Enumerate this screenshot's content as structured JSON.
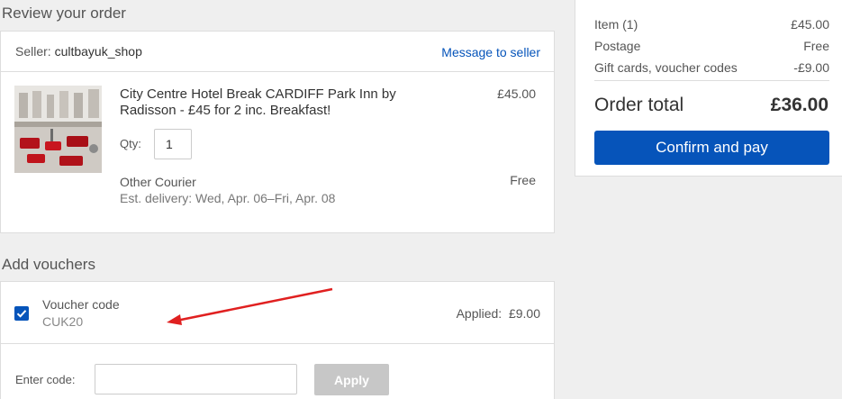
{
  "review": {
    "heading": "Review your order",
    "seller_label": "Seller:",
    "seller_name": "cultbayuk_shop",
    "message_link": "Message to seller",
    "item": {
      "title": "City Centre Hotel Break CARDIFF Park Inn by Radisson - £45 for 2 inc. Breakfast!",
      "price": "£45.00",
      "qty_label": "Qty:",
      "qty_value": "1",
      "courier": "Other Courier",
      "delivery": "Est. delivery: Wed, Apr. 06–Fri, Apr. 08",
      "shipping_cost": "Free"
    }
  },
  "vouchers": {
    "heading": "Add vouchers",
    "voucher_label": "Voucher code",
    "voucher_code": "CUK20",
    "applied_text": "Applied:  £9.00",
    "enter_label": "Enter code:",
    "enter_value": "",
    "apply_button": "Apply"
  },
  "summary": {
    "rows": [
      {
        "label": "Item (1)",
        "value": "£45.00"
      },
      {
        "label": "Postage",
        "value": "Free"
      },
      {
        "label": "Gift cards, voucher codes",
        "value": "-£9.00"
      }
    ],
    "total_label": "Order total",
    "total_value": "£36.00",
    "confirm_button": "Confirm and pay"
  },
  "colors": {
    "accent": "#0654ba",
    "annotation": "#e02020"
  },
  "icons": {
    "checkbox": "checkmark-icon",
    "item_image": "hotel-lobby-photo"
  }
}
